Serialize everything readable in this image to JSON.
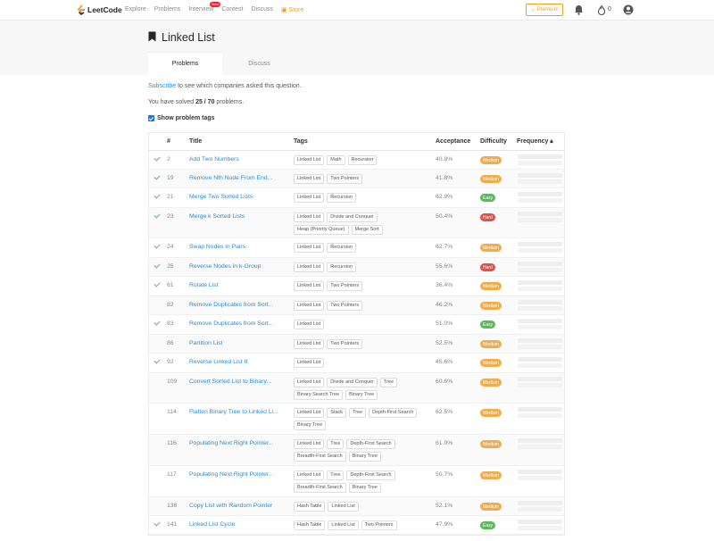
{
  "nav": {
    "logo": "LeetCode",
    "links": [
      "Explore",
      "Problems",
      "Interview",
      "Contest",
      "Discuss",
      "Store"
    ],
    "new_badge": "New",
    "premium": "Premium",
    "notif_count": "0"
  },
  "header": {
    "title": "Linked List",
    "tabs": [
      "Problems",
      "Discuss"
    ]
  },
  "info": {
    "subscribe_link": "Subscribe",
    "subscribe_text": " to see which companies asked this question.",
    "solved_prefix": "You have solved ",
    "solved_value": "25 / 70",
    "solved_suffix": " problems.",
    "show_tags": "Show problem tags"
  },
  "table": {
    "headers": [
      "#",
      "Title",
      "Tags",
      "Acceptance",
      "Difficulty",
      "Frequency"
    ],
    "rows": [
      {
        "solved": true,
        "num": "2",
        "title": "Add Two Numbers",
        "tags": [
          "Linked List",
          "Math",
          "Recursion"
        ],
        "acc": "40.8%",
        "diff": "Medium"
      },
      {
        "solved": true,
        "num": "19",
        "title": "Remove Nth Node From End...",
        "tags": [
          "Linked List",
          "Two Pointers"
        ],
        "acc": "41.8%",
        "diff": "Medium"
      },
      {
        "solved": true,
        "num": "21",
        "title": "Merge Two Sorted Lists",
        "tags": [
          "Linked List",
          "Recursion"
        ],
        "acc": "62.9%",
        "diff": "Easy"
      },
      {
        "solved": true,
        "num": "23",
        "title": "Merge k Sorted Lists",
        "tags": [
          "Linked List",
          "Divide and Conquer",
          "Heap (Priority Queue)",
          "Merge Sort"
        ],
        "acc": "50.4%",
        "diff": "Hard"
      },
      {
        "solved": true,
        "num": "24",
        "title": "Swap Nodes in Pairs",
        "tags": [
          "Linked List",
          "Recursion"
        ],
        "acc": "62.7%",
        "diff": "Medium"
      },
      {
        "solved": true,
        "num": "25",
        "title": "Reverse Nodes in k-Group",
        "tags": [
          "Linked List",
          "Recursion"
        ],
        "acc": "55.6%",
        "diff": "Hard"
      },
      {
        "solved": true,
        "num": "61",
        "title": "Rotate List",
        "tags": [
          "Linked List",
          "Two Pointers"
        ],
        "acc": "36.4%",
        "diff": "Medium"
      },
      {
        "solved": false,
        "num": "82",
        "title": "Remove Duplicates from Sort...",
        "tags": [
          "Linked List",
          "Two Pointers"
        ],
        "acc": "46.2%",
        "diff": "Medium"
      },
      {
        "solved": true,
        "num": "83",
        "title": "Remove Duplicates from Sort...",
        "tags": [
          "Linked List"
        ],
        "acc": "51.0%",
        "diff": "Easy"
      },
      {
        "solved": false,
        "num": "86",
        "title": "Partition List",
        "tags": [
          "Linked List",
          "Two Pointers"
        ],
        "acc": "52.5%",
        "diff": "Medium"
      },
      {
        "solved": true,
        "num": "92",
        "title": "Reverse Linked List II",
        "tags": [
          "Linked List"
        ],
        "acc": "45.6%",
        "diff": "Medium"
      },
      {
        "solved": false,
        "num": "109",
        "title": "Convert Sorted List to Binary...",
        "tags": [
          "Linked List",
          "Divide and Conquer",
          "Tree",
          "Binary Search Tree",
          "Binary Tree"
        ],
        "acc": "60.6%",
        "diff": "Medium"
      },
      {
        "solved": false,
        "num": "114",
        "title": "Flatten Binary Tree to Linked Li...",
        "tags": [
          "Linked List",
          "Stack",
          "Tree",
          "Depth-First Search",
          "Binary Tree"
        ],
        "acc": "62.5%",
        "diff": "Medium"
      },
      {
        "solved": false,
        "num": "116",
        "title": "Populating Next Right Pointer...",
        "tags": [
          "Linked List",
          "Tree",
          "Depth-First Search",
          "Breadth-First Search",
          "Binary Tree"
        ],
        "acc": "61.0%",
        "diff": "Medium"
      },
      {
        "solved": false,
        "num": "117",
        "title": "Populating Next Right Pointer...",
        "tags": [
          "Linked List",
          "Tree",
          "Depth-First Search",
          "Breadth-First Search",
          "Binary Tree"
        ],
        "acc": "50.7%",
        "diff": "Medium"
      },
      {
        "solved": false,
        "num": "138",
        "title": "Copy List with Random Pointer",
        "tags": [
          "Hash Table",
          "Linked List"
        ],
        "acc": "52.1%",
        "diff": "Medium"
      },
      {
        "solved": true,
        "num": "141",
        "title": "Linked List Cycle",
        "tags": [
          "Hash Table",
          "Linked List",
          "Two Pointers"
        ],
        "acc": "47.9%",
        "diff": "Easy"
      }
    ]
  },
  "colors": {
    "easy": "#5cb85c",
    "medium": "#f0ad4e",
    "hard": "#d9534f",
    "link": "#1890ff"
  }
}
